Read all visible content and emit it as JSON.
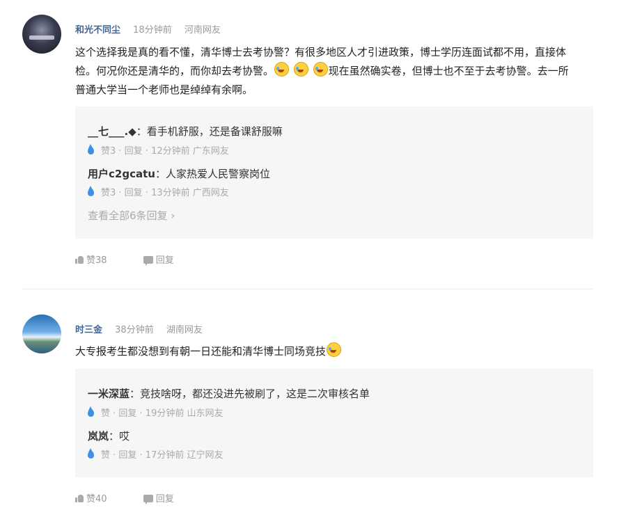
{
  "comments": [
    {
      "user": "和光不同尘",
      "time": "18分钟前",
      "location": "河南网友",
      "text_line1": "这个选择我是真的看不懂，清华博士去考协警？有很多地区人才引进政策，博士学历连面试都不用，直接体",
      "text_line2_a": "检。何况你还是清华的，而你却去考协警。",
      "text_line2_b": "现在虽然确实卷，但博士也不至于去考协警。去一所",
      "text_line3": "普通大学当一个老师也是绰绰有余啊。",
      "replies": [
        {
          "user": "__七___.◆",
          "text": "：看手机舒服，还是备课舒服嘛",
          "meta": "赞3 · 回复 · 12分钟前 广东网友"
        },
        {
          "user": "用户c2gcatu",
          "text": "：人家热爱人民警察岗位",
          "meta": "赞3 · 回复 · 13分钟前 广西网友"
        }
      ],
      "view_all": "查看全部6条回复 ›",
      "like_label": "赞38",
      "reply_label": "回复"
    },
    {
      "user": "时三金",
      "time": "38分钟前",
      "location": "湖南网友",
      "text": "大专报考生都没想到有朝一日还能和清华博士同场竞技",
      "replies": [
        {
          "user": "一米深蓝",
          "text": "：竞技啥呀，都还没进先被刷了，这是二次审核名单",
          "meta": "赞 · 回复 · 19分钟前 山东网友"
        },
        {
          "user": "岚岚",
          "text": "：哎",
          "meta": "赞 · 回复 · 17分钟前 辽宁网友"
        }
      ],
      "like_label": "赞40",
      "reply_label": "回复"
    }
  ],
  "icons": {
    "like": "thumbs-up-icon",
    "reply": "comment-bubble-icon",
    "reply_like": "water-drop-icon",
    "emoji": "crying-laugh-emoji-icon"
  },
  "colors": {
    "username": "#406599",
    "drop": "#3e90e4",
    "reply_bg": "#f6f6f6"
  }
}
